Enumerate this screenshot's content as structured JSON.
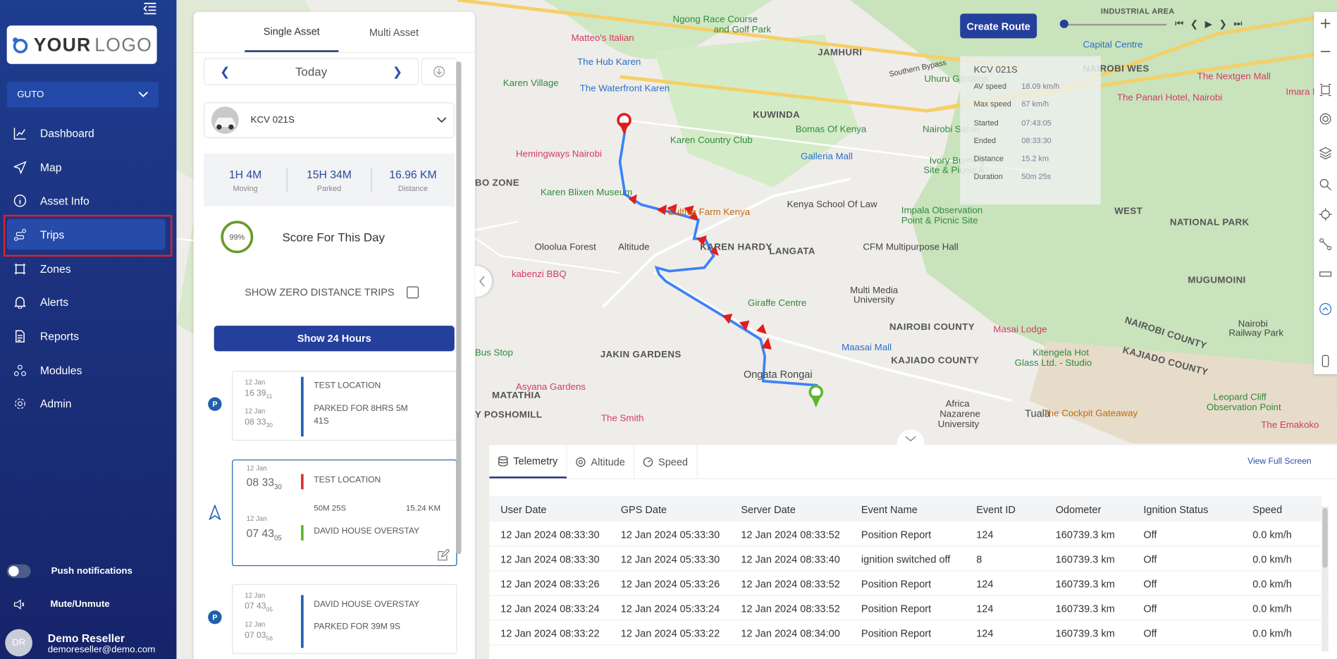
{
  "sidebar": {
    "logo_text_a": "YOUR",
    "logo_text_b": "LOGO",
    "org": "GUTO",
    "items": [
      {
        "label": "Dashboard",
        "icon": "chart-line-icon"
      },
      {
        "label": "Map",
        "icon": "navigation-arrow-icon"
      },
      {
        "label": "Asset Info",
        "icon": "info-icon"
      },
      {
        "label": "Trips",
        "icon": "route-icon"
      },
      {
        "label": "Zones",
        "icon": "zone-icon"
      },
      {
        "label": "Alerts",
        "icon": "bell-icon"
      },
      {
        "label": "Reports",
        "icon": "document-icon"
      },
      {
        "label": "Modules",
        "icon": "modules-icon"
      },
      {
        "label": "Admin",
        "icon": "gear-icon"
      }
    ],
    "push_label": "Push notifications",
    "mute_label": "Mute/Unmute",
    "user": {
      "initials": "DR",
      "name": "Demo Reseller",
      "email": "demoreseller@demo.com"
    }
  },
  "panel": {
    "tabs": [
      "Single Asset",
      "Multi Asset"
    ],
    "day": "Today",
    "asset": "KCV 021S",
    "stats": [
      {
        "value": "1H 4M",
        "label": "Moving"
      },
      {
        "value": "15H 34M",
        "label": "Parked"
      },
      {
        "value": "16.96 KM",
        "label": "Distance"
      }
    ],
    "score_pct": "99%",
    "score_label": "Score For This Day",
    "zero_label": "SHOW ZERO DISTANCE TRIPS",
    "show24": "Show 24 Hours",
    "card1": {
      "badge": "P",
      "d1": "12 Jan",
      "t1": "16 39",
      "s1": "11",
      "d2": "12 Jan",
      "t2": "08 33",
      "s2": "30",
      "title": "TEST LOCATION",
      "sub1": "PARKED FOR 8HRS 5M",
      "sub2": "41S"
    },
    "card2": {
      "d1": "12 Jan",
      "t1": "08 33",
      "s1": "30",
      "d2": "12 Jan",
      "t2": "07 43",
      "s2": "05",
      "from": "TEST LOCATION",
      "dur": "50M 25S",
      "dist": "15.24 KM",
      "to": "DAVID HOUSE OVERSTAY"
    },
    "card3": {
      "badge": "P",
      "d1": "12 Jan",
      "t1": "07 43",
      "s1": "05",
      "d2": "12 Jan",
      "t2": "07 03",
      "s2": "56",
      "title": "DAVID HOUSE OVERSTAY",
      "sub1": "PARKED FOR 39M 9S"
    }
  },
  "map": {
    "create_route": "Create Route",
    "info": {
      "title": "KCV 021S",
      "rows": [
        {
          "k": "AV speed",
          "v": "18.09 km/h"
        },
        {
          "k": "Max speed",
          "v": "67 km/h"
        },
        {
          "k": "Started",
          "v": "07:43:05"
        },
        {
          "k": "Ended",
          "v": "08:33:30"
        },
        {
          "k": "Distance",
          "v": "15.2 km"
        },
        {
          "k": "Duration",
          "v": "50m 25s"
        }
      ]
    },
    "labels": {
      "ngong_race": "Ngong Race Course",
      "golf_park": "and Golf Park",
      "mattteo": "Matteo's Italian",
      "jamhuri": "JAMHURI",
      "hub": "The Hub Karen",
      "waterfront": "The Waterfront Karen",
      "karen_village": "Karen Village",
      "hemingways": "Hemingways Nairobi",
      "karen_cc": "Karen Country Club",
      "kuwinda": "KUWINDA",
      "bomas": "Bomas Of Kenya",
      "galleria": "Galleria Mall",
      "uhuru": "Uhuru Gardens",
      "nairobi_safari": "Nairobi Safari",
      "ivory1": "Ivory Burning",
      "ivory2": "Site & Picnic A",
      "blixen": "Karen Blixen Museum",
      "cultiva": "Cultiva Farm Kenya",
      "kenya_law": "Kenya School Of Law",
      "impala1": "Impala Observation",
      "impala2": "Point & Picnic Site",
      "west": "WEST",
      "national_park": "NATIONAL PARK",
      "oloolua": "Oloolua Forest",
      "altitude_map": "Altitude",
      "karen_hardy": "KAREN HARDY",
      "langata": "LANGATA",
      "cfm": "CFM Multipurpose Hall",
      "kabenzi": "kabenzi BBQ",
      "mmu1": "Multi Media",
      "mmu2": "University",
      "giraffe": "Giraffe Centre",
      "mugumoini": "MUGUMOINI",
      "nairobi_county": "NAIROBI COUNTY",
      "masai_lodge": "Masai Lodge",
      "nairobi_county2": "NAIROBI COUNTY",
      "jakin": "JAKIN GARDENS",
      "maasai_mall": "Maasai Mall",
      "ongata": "Ongata Rongai",
      "kitengela1": "Kitengela Hot",
      "kitengela2": "Glass Ltd. - Studio",
      "kajiado": "KAJIADO COUNTY",
      "kajiado2": "KAJIADO COUNTY",
      "nairobi_rp1": "Nairobi",
      "nairobi_rp2": "Railway Park",
      "asyana": "Asyana Gardens",
      "matathia": "MATATHIA",
      "poshomill": "Y POSHOMILL",
      "smith": "The Smith",
      "africa1": "Africa",
      "africa2": "Nazarene",
      "africa3": "University",
      "tuala": "Tuala",
      "cockpit": "The Cockpit Gateaway",
      "leopard1": "Leopard Cliff",
      "leopard2": "Observation Point",
      "emakoko": "The Emakoko",
      "capital": "Capital Centre",
      "nairobi_w": "NAIROBI WES",
      "nextgen": "The Nextgen Mall",
      "imara": "Imara Diama",
      "panari": "The Panari Hotel, Nairobi",
      "southern_bypass": "Southern Bypass",
      "zone": "BO ZONE",
      "bus_stop": "Bus Stop",
      "industrial": "INDUSTRIAL AREA"
    }
  },
  "bottom": {
    "tabs": [
      "Telemetry",
      "Altitude",
      "Speed"
    ],
    "view_full": "View Full Screen",
    "columns": [
      "User Date",
      "GPS Date",
      "Server Date",
      "Event Name",
      "Event ID",
      "Odometer",
      "Ignition Status",
      "Speed"
    ],
    "rows": [
      [
        "12 Jan 2024 08:33:30",
        "12 Jan 2024 05:33:30",
        "12 Jan 2024 08:33:52",
        "Position Report",
        "124",
        "160739.3 km",
        "Off",
        "0.0 km/h"
      ],
      [
        "12 Jan 2024 08:33:30",
        "12 Jan 2024 05:33:30",
        "12 Jan 2024 08:33:40",
        "ignition switched off",
        "8",
        "160739.3 km",
        "Off",
        "0.0 km/h"
      ],
      [
        "12 Jan 2024 08:33:26",
        "12 Jan 2024 05:33:26",
        "12 Jan 2024 08:33:52",
        "Position Report",
        "124",
        "160739.3 km",
        "Off",
        "0.0 km/h"
      ],
      [
        "12 Jan 2024 08:33:24",
        "12 Jan 2024 05:33:24",
        "12 Jan 2024 08:33:52",
        "Position Report",
        "124",
        "160739.3 km",
        "Off",
        "0.0 km/h"
      ],
      [
        "12 Jan 2024 08:33:22",
        "12 Jan 2024 05:33:22",
        "12 Jan 2024 08:34:00",
        "Position Report",
        "124",
        "160739.3 km",
        "Off",
        "0.0 km/h"
      ]
    ]
  },
  "colors": {
    "sidebar": "#1e3d8f",
    "accent": "#243f9c",
    "route": "#3b82f6",
    "arrow": "#e11d1d",
    "highlight": "#e0202a"
  }
}
